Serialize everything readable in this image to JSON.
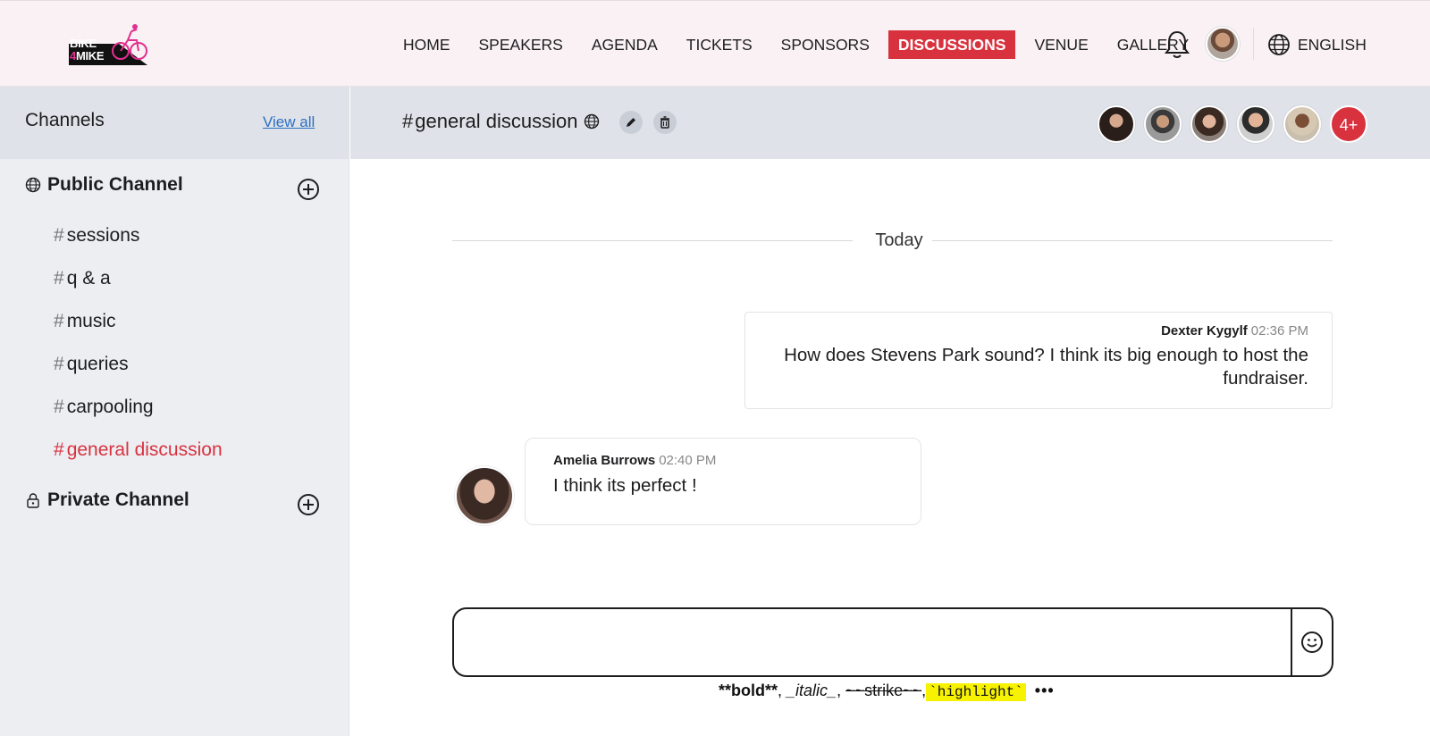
{
  "brand": {
    "logo_line1": "BIKE",
    "logo_4": "4",
    "logo_line2": "MIKE"
  },
  "nav": {
    "items": [
      "HOME",
      "SPEAKERS",
      "AGENDA",
      "TICKETS",
      "SPONSORS",
      "DISCUSSIONS",
      "VENUE",
      "GALLERY"
    ],
    "active": "DISCUSSIONS",
    "language": "ENGLISH"
  },
  "sidebar": {
    "title": "Channels",
    "view_all": "View all",
    "public_title": "Public Channel",
    "public_channels": [
      "sessions",
      "q & a",
      "music",
      "queries",
      "carpooling",
      "general discussion"
    ],
    "active_channel": "general discussion",
    "private_title": "Private Channel",
    "hash": "#"
  },
  "channel_header": {
    "hash": "#",
    "name": "general discussion",
    "more_members": "4+"
  },
  "conversation": {
    "divider": "Today",
    "messages": [
      {
        "author": "Dexter Kygylf",
        "time": "02:36 PM",
        "text": "How does Stevens Park sound? I think its big enough to host the fundraiser.",
        "side": "right"
      },
      {
        "author": "Amelia Burrows",
        "time": "02:40 PM",
        "text": "I think its perfect !",
        "side": "left"
      }
    ]
  },
  "composer": {
    "placeholder": "",
    "hints": {
      "bold": "**bold**",
      "sep1": ", ",
      "italic": "_italic_",
      "sep2": ", ",
      "strike": "~~strike~~",
      "sep3": ",",
      "highlight": "`highlight`",
      "more": "•••"
    }
  },
  "colors": {
    "accent": "#d9323f",
    "link": "#2d6fc2",
    "sidebar_bg": "#eceef2",
    "header_bg": "#dfe3e9",
    "topbar_bg": "#f9f1f4",
    "highlight": "#f7f200"
  },
  "icons": {
    "notifications": "bell-icon",
    "language": "globe-icon",
    "public": "globe-icon",
    "private": "lock-icon",
    "add": "plus-circle-icon",
    "edit": "pencil-icon",
    "delete": "trash-icon",
    "emoji": "smiley-icon"
  }
}
